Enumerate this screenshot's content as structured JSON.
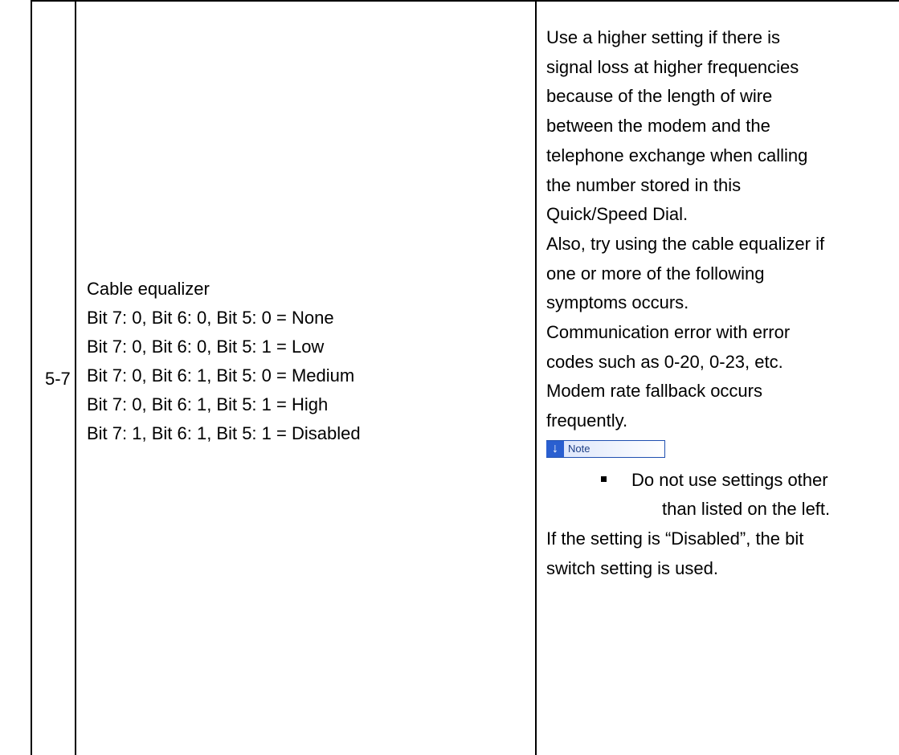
{
  "row": {
    "number": "5-7",
    "setting_lines": [
      "Cable equalizer",
      "Bit 7: 0, Bit 6: 0, Bit 5: 0 = None",
      "Bit 7: 0, Bit 6: 0, Bit 5: 1 = Low",
      "Bit 7: 0, Bit 6: 1, Bit 5: 0 = Medium",
      "Bit 7: 0, Bit 6: 1, Bit 5: 1 = High",
      "Bit 7: 1, Bit 6: 1, Bit 5: 1 = Disabled"
    ],
    "description_lines": [
      "Use a higher setting if there is",
      "signal loss at higher frequencies",
      "because of the length of wire",
      "between the modem and the",
      "telephone exchange when calling",
      "the number stored in this",
      "Quick/Speed Dial.",
      "Also, try using the cable equalizer if",
      "one or more of the following",
      "symptoms occurs.",
      "Communication error with error",
      "codes such as 0-20, 0-23, etc.",
      "Modem rate fallback occurs",
      "frequently."
    ],
    "note": {
      "label": "Note",
      "icon": "down-arrow-icon",
      "bullet_line1": "Do not use settings other",
      "bullet_line2": "than listed on the left."
    },
    "footer_lines": [
      "If the setting is “Disabled”, the bit",
      "switch setting is used."
    ]
  }
}
